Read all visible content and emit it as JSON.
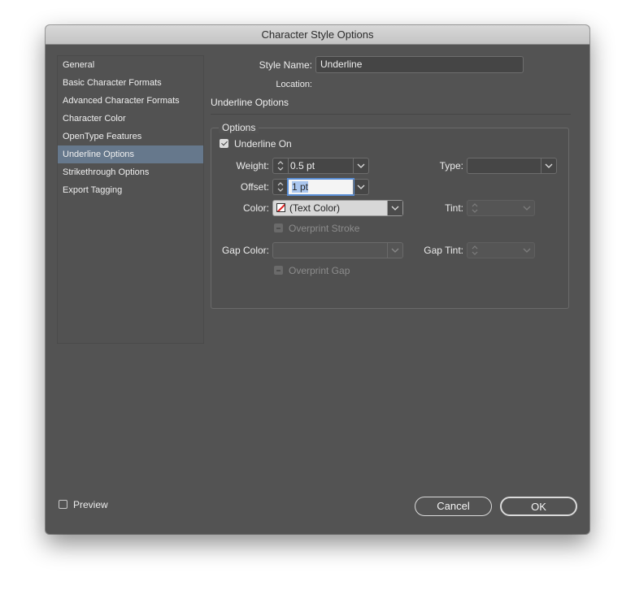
{
  "window": {
    "title": "Character Style Options"
  },
  "sidebar": {
    "items": [
      {
        "label": "General",
        "selected": false
      },
      {
        "label": "Basic Character Formats",
        "selected": false
      },
      {
        "label": "Advanced Character Formats",
        "selected": false
      },
      {
        "label": "Character Color",
        "selected": false
      },
      {
        "label": "OpenType Features",
        "selected": false
      },
      {
        "label": "Underline Options",
        "selected": true
      },
      {
        "label": "Strikethrough Options",
        "selected": false
      },
      {
        "label": "Export Tagging",
        "selected": false
      }
    ]
  },
  "main": {
    "style_name_label": "Style Name:",
    "style_name_value": "Underline",
    "location_label": "Location:",
    "section_title": "Underline Options",
    "group_title": "Options",
    "underline_on_label": "Underline On",
    "underline_on_checked": true,
    "weight_label": "Weight:",
    "weight_value": "0.5 pt",
    "type_label": "Type:",
    "type_value": "",
    "offset_label": "Offset:",
    "offset_value": "1 pt",
    "color_label": "Color:",
    "color_value": "(Text Color)",
    "tint_label": "Tint:",
    "overprint_stroke_label": "Overprint Stroke",
    "gap_color_label": "Gap Color:",
    "gap_tint_label": "Gap Tint:",
    "overprint_gap_label": "Overprint Gap"
  },
  "footer": {
    "preview_label": "Preview",
    "preview_checked": false,
    "cancel_label": "Cancel",
    "ok_label": "OK"
  },
  "colors": {
    "dialog_bg": "#535353",
    "selection": "#66788c",
    "focus_ring": "#5a8ed6"
  }
}
